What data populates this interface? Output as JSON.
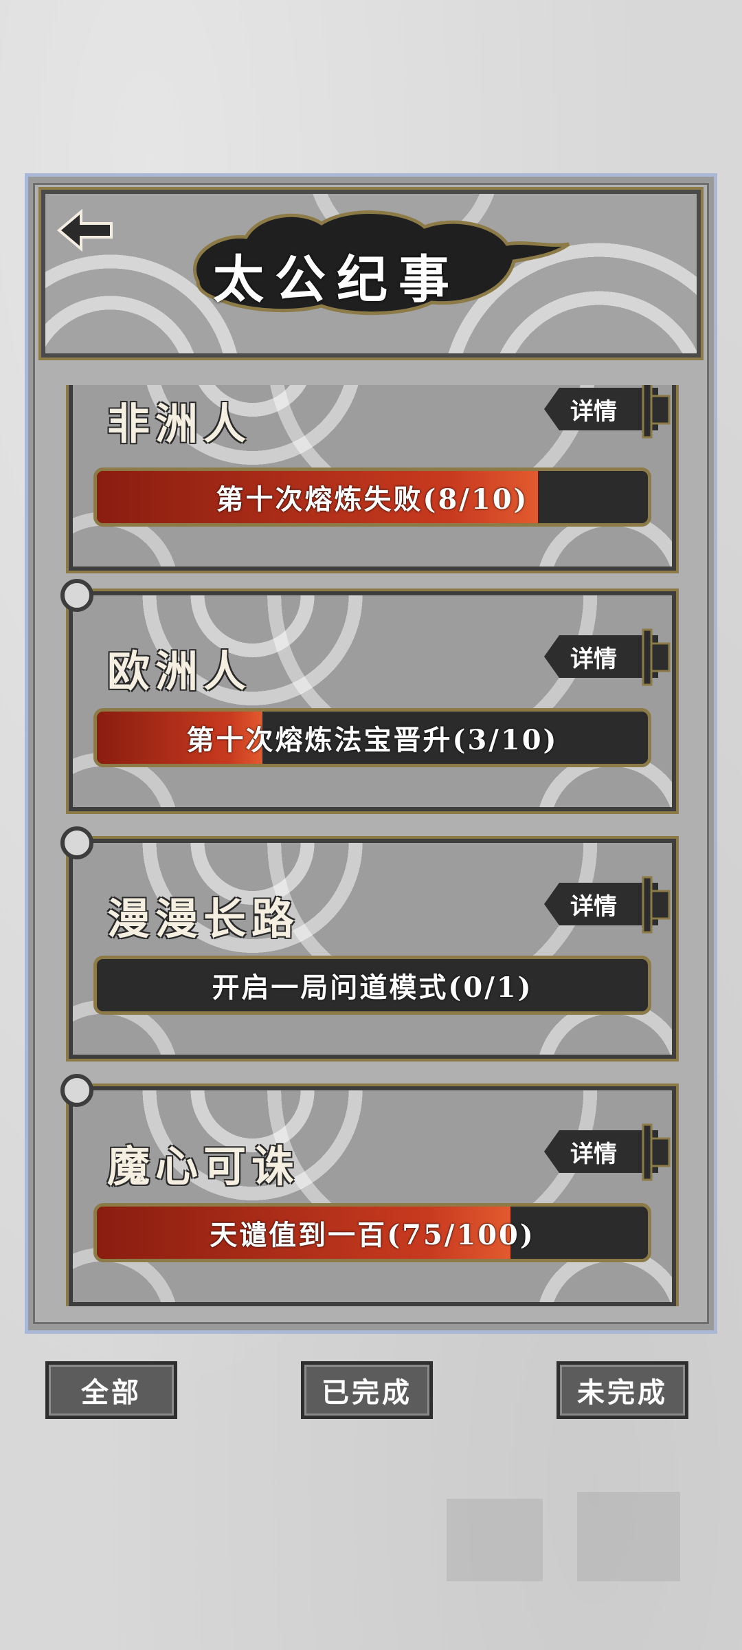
{
  "header": {
    "title": "太公纪事",
    "back_icon": "arrow-left-icon"
  },
  "achievements": [
    {
      "title": "非洲人",
      "detail_label": "详情",
      "progress_text": "第十次熔炼失败(8/10)",
      "progress": 0.8
    },
    {
      "title": "欧洲人",
      "detail_label": "详情",
      "progress_text": "第十次熔炼法宝晋升(3/10)",
      "progress": 0.3
    },
    {
      "title": "漫漫长路",
      "detail_label": "详情",
      "progress_text": "开启一局问道模式(0/1)",
      "progress": 0.0
    },
    {
      "title": "魔心可诛",
      "detail_label": "详情",
      "progress_text": "天谴值到一百(75/100)",
      "progress": 0.75
    }
  ],
  "filters": {
    "all": "全部",
    "completed": "已完成",
    "incomplete": "未完成"
  },
  "colors": {
    "accent_gold": "#8c7a47",
    "progress_red": "#c83a1f",
    "frame_blue": "#aab8d7"
  }
}
